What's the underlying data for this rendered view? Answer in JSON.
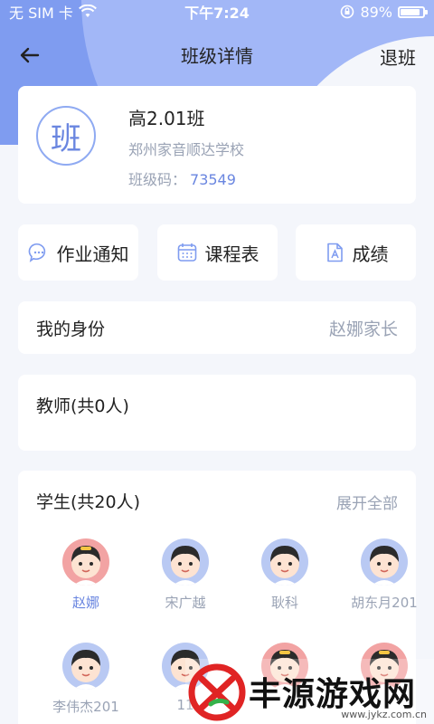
{
  "status": {
    "carrier": "无 SIM 卡",
    "time": "下午7:24",
    "battery": "89%",
    "battery_level": 0.89
  },
  "nav": {
    "title": "班级详情",
    "exit_label": "退班"
  },
  "class": {
    "logo_char": "班",
    "name": "高2.01班",
    "school": "郑州家音顺达学校",
    "code_label": "班级码：",
    "code_value": "73549"
  },
  "quick_actions": [
    {
      "label": "作业通知",
      "icon": "message-icon"
    },
    {
      "label": "课程表",
      "icon": "calendar-icon"
    },
    {
      "label": "成绩",
      "icon": "document-icon"
    }
  ],
  "identity": {
    "label": "我的身份",
    "value": "赵娜家长"
  },
  "teachers": {
    "label": "教师(共0人)"
  },
  "students": {
    "label": "学生(共20人)",
    "expand_label": "展开全部",
    "items": [
      {
        "name": "赵娜",
        "gender": "girl"
      },
      {
        "name": "宋广越",
        "gender": "boy"
      },
      {
        "name": "耿科",
        "gender": "boy"
      },
      {
        "name": "胡东月201",
        "gender": "boy"
      },
      {
        "name": "李伟杰201",
        "gender": "boy"
      },
      {
        "name": "11",
        "gender": "boy"
      },
      {
        "name": "",
        "gender": "girl"
      },
      {
        "name": "",
        "gender": "girl"
      }
    ]
  },
  "watermark": {
    "text": "丰源游戏网",
    "url": "www.jykz.com.cn"
  },
  "colors": {
    "accent": "#6a86e0",
    "header": "#7f9cf0",
    "muted": "#9aa3b5"
  }
}
